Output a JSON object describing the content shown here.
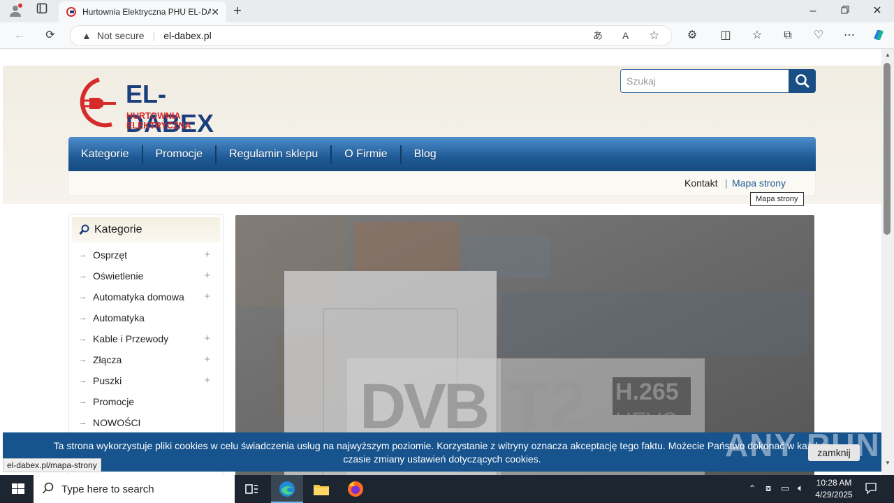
{
  "browser": {
    "tab_title": "Hurtownia Elektryczna PHU EL-DABEX",
    "security_label": "Not secure",
    "url": "el-dabex.pl"
  },
  "site": {
    "logo_name": "EL-DABEX",
    "logo_tagline": "HURTOWNIA ELEKTRYCZNA",
    "search_placeholder": "Szukaj",
    "nav": [
      "Kategorie",
      "Promocje",
      "Regulamin sklepu",
      "O Firmie",
      "Blog"
    ],
    "subnav": {
      "contact": "Kontakt",
      "separator": "|",
      "sitemap": "Mapa strony"
    },
    "tooltip": "Mapa strony"
  },
  "sidebar": {
    "title": "Kategorie",
    "items": [
      {
        "label": "Osprzęt",
        "expandable": "+"
      },
      {
        "label": "Oświetlenie",
        "expandable": "+"
      },
      {
        "label": "Automatyka domowa",
        "expandable": "+"
      },
      {
        "label": "Automatyka",
        "expandable": ""
      },
      {
        "label": "Kable i Przewody",
        "expandable": "+"
      },
      {
        "label": "Złącza",
        "expandable": "+"
      },
      {
        "label": "Puszki",
        "expandable": "+"
      },
      {
        "label": "Promocje",
        "expandable": ""
      },
      {
        "label": "NOWOŚCI",
        "expandable": ""
      }
    ]
  },
  "banner": {
    "dvb": "DVB",
    "t2": "T2",
    "codec_top": "H.265",
    "codec_bottom": "HEVC"
  },
  "cookie": {
    "line1": "Ta strona wykorzystuje pliki cookies w celu świadczenia usług na najwyższym poziomie. Korzystanie z witryny oznacza akceptację tego faktu. Możecie Państwo dokonać w każdym",
    "line2": "czasie zmiany ustawień dotyczących cookies.",
    "button": "zamknij"
  },
  "watermark": "ANY RUN",
  "status_url": "el-dabex.pl/mapa-strony",
  "taskbar": {
    "search_placeholder": "Type here to search",
    "time": "10:28 AM",
    "date": "4/29/2025"
  },
  "colors": {
    "nav": "#1f5a95",
    "cookie_bar": "#17538d",
    "logo_red": "#d52b2b",
    "logo_blue": "#1b3e7c"
  }
}
